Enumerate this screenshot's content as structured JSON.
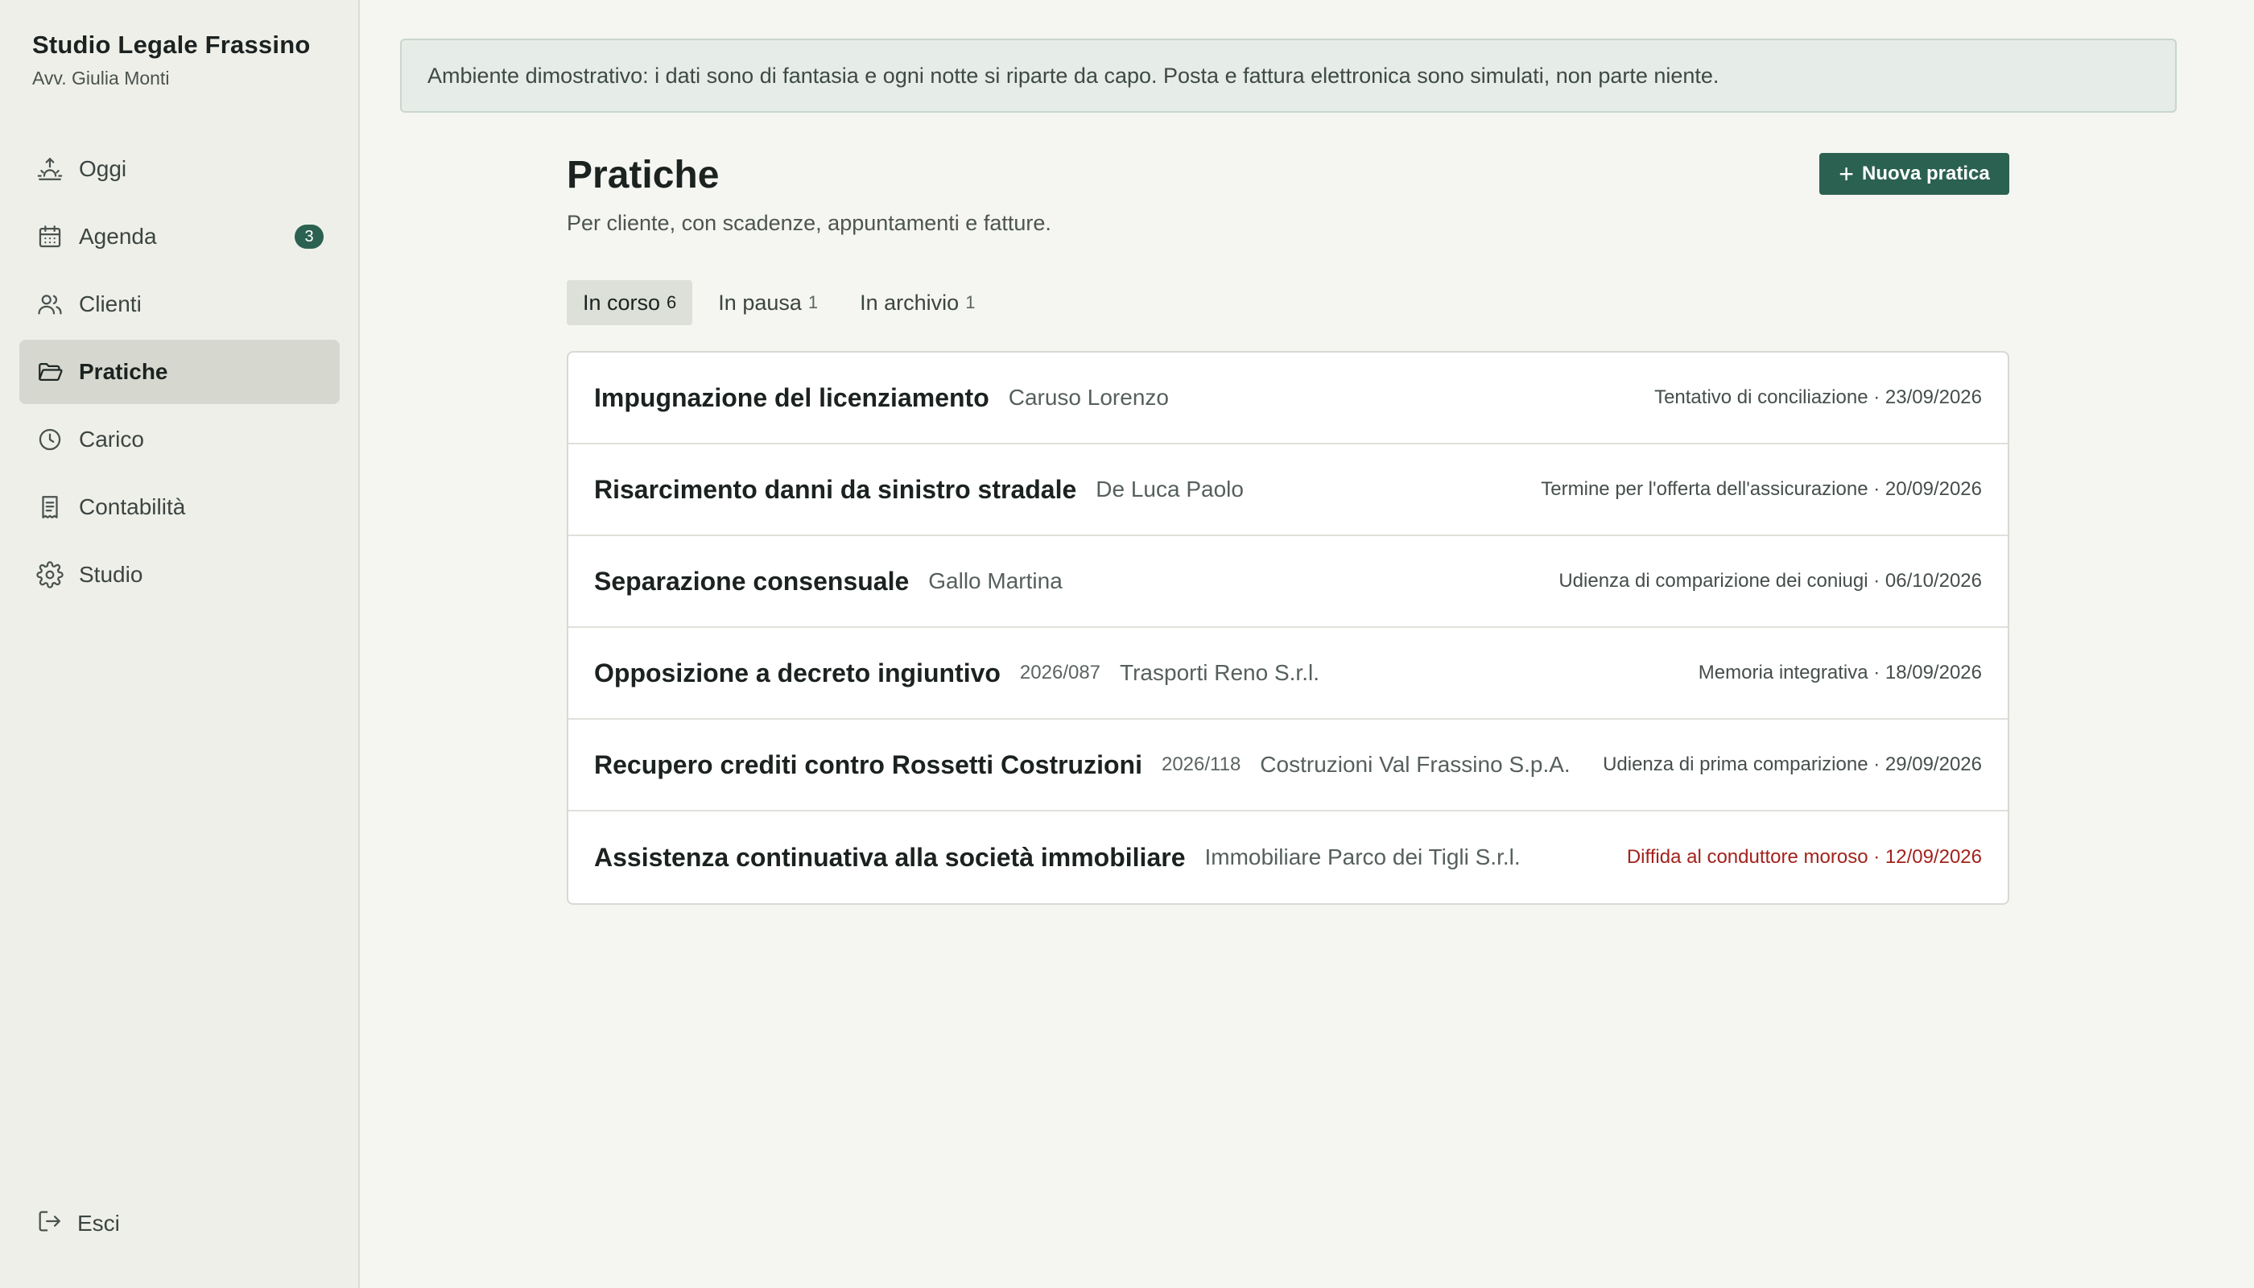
{
  "sidebar": {
    "brand_title": "Studio Legale Frassino",
    "brand_sub": "Avv. Giulia Monti",
    "items": [
      {
        "label": "Oggi",
        "icon": "sunrise-icon"
      },
      {
        "label": "Agenda",
        "icon": "calendar-icon",
        "badge": "3"
      },
      {
        "label": "Clienti",
        "icon": "users-icon"
      },
      {
        "label": "Pratiche",
        "icon": "folder-open-icon",
        "active": true
      },
      {
        "label": "Carico",
        "icon": "clock-icon"
      },
      {
        "label": "Contabilità",
        "icon": "receipt-icon"
      },
      {
        "label": "Studio",
        "icon": "gear-icon"
      }
    ],
    "logout_label": "Esci"
  },
  "banner": {
    "text": "Ambiente dimostrativo: i dati sono di fantasia e ogni notte si riparte da capo. Posta e fattura elettronica sono simulati, non parte niente."
  },
  "main": {
    "title": "Pratiche",
    "subtitle": "Per cliente, con scadenze, appuntamenti e fatture.",
    "new_button": "Nuova pratica",
    "tabs": [
      {
        "label": "In corso",
        "count": "6",
        "active": true
      },
      {
        "label": "In pausa",
        "count": "1"
      },
      {
        "label": "In archivio",
        "count": "1"
      }
    ],
    "cases": [
      {
        "title": "Impugnazione del licenziamento",
        "number": "",
        "client": "Caruso Lorenzo",
        "deadline": "Tentativo di conciliazione · 23/09/2026",
        "urgent": false
      },
      {
        "title": "Risarcimento danni da sinistro stradale",
        "number": "",
        "client": "De Luca Paolo",
        "deadline": "Termine per l'offerta dell'assicurazione · 20/09/2026",
        "urgent": false
      },
      {
        "title": "Separazione consensuale",
        "number": "",
        "client": "Gallo Martina",
        "deadline": "Udienza di comparizione dei coniugi · 06/10/2026",
        "urgent": false
      },
      {
        "title": "Opposizione a decreto ingiuntivo",
        "number": "2026/087",
        "client": "Trasporti Reno S.r.l.",
        "deadline": "Memoria integrativa · 18/09/2026",
        "urgent": false
      },
      {
        "title": "Recupero crediti contro Rossetti Costruzioni",
        "number": "2026/118",
        "client": "Costruzioni Val Frassino S.p.A.",
        "deadline": "Udienza di prima comparizione · 29/09/2026",
        "urgent": false
      },
      {
        "title": "Assistenza continuativa alla società immobiliare",
        "number": "",
        "client": "Immobiliare Parco dei Tigli S.r.l.",
        "deadline": "Diffida al conduttore moroso · 12/09/2026",
        "urgent": true
      }
    ]
  },
  "colors": {
    "accent": "#2b6150",
    "urgent": "#a3221c",
    "sidebar_bg": "#efefea",
    "page_bg": "#f5f5f1"
  }
}
